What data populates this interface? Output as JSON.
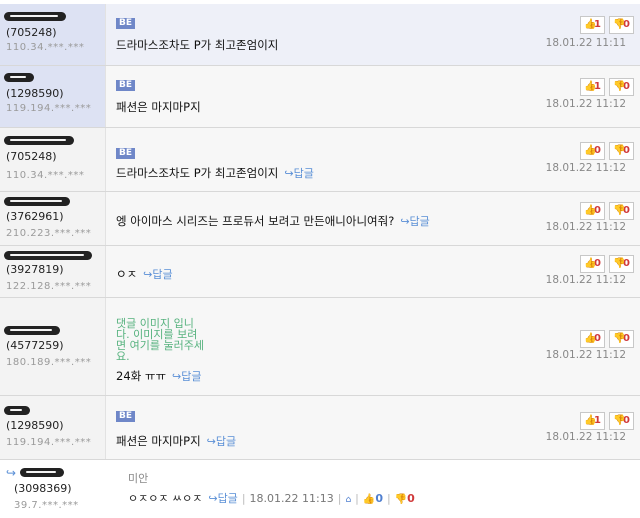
{
  "comments": [
    {
      "user_id": "(705248)",
      "ip": "110.34.***.***",
      "badge": "BE",
      "text": "드라마스조차도 P가 최고존엄이지",
      "reply_label": "",
      "up": "1",
      "down": "0",
      "date": "18.01.22 11:11"
    },
    {
      "user_id": "(1298590)",
      "ip": "119.194.***.***",
      "badge": "BE",
      "text": "패션은 마지마P지",
      "reply_label": "",
      "up": "1",
      "down": "0",
      "date": "18.01.22 11:12"
    },
    {
      "user_id": "(705248)",
      "ip": "110.34.***.***",
      "badge": "BE",
      "text": "드라마스조차도 P가 최고존엄이지",
      "reply_label": "답글",
      "up": "0",
      "down": "0",
      "date": "18.01.22 11:12"
    },
    {
      "user_id": "(3762961)",
      "ip": "210.223.***.***",
      "badge": "",
      "text": "엥 아이마스 시리즈는 프로듀서 보려고 만든애니아니여줘?",
      "reply_label": "답글",
      "up": "0",
      "down": "0",
      "date": "18.01.22 11:12"
    },
    {
      "user_id": "(3927819)",
      "ip": "122.128.***.***",
      "badge": "",
      "text": "ㅇㅈ",
      "reply_label": "답글",
      "up": "0",
      "down": "0",
      "date": "18.01.22 11:12"
    },
    {
      "user_id": "(4577259)",
      "ip": "180.189.***.***",
      "badge": "",
      "image_text": [
        "댓글 이미지 입니",
        "다. 이미지를 보려",
        "면 여기를 눌러주세",
        "요."
      ],
      "text": "24화 ㅠㅠ",
      "reply_label": "답글",
      "up": "0",
      "down": "0",
      "date": "18.01.22 11:12"
    },
    {
      "user_id": "(1298590)",
      "ip": "119.194.***.***",
      "badge": "BE",
      "text": "패션은 마지마P지",
      "reply_label": "답글",
      "up": "1",
      "down": "0",
      "date": "18.01.22 11:12"
    }
  ],
  "last_reply": {
    "reply_to": "미안",
    "user_id": "(3098369)",
    "ip": "39.7.***.***",
    "text": "ㅇㅈㅇㅈ ㅆㅇㅈ",
    "reply_label": "답글",
    "date": "18.01.22 11:13",
    "up": "0",
    "down": "0"
  }
}
